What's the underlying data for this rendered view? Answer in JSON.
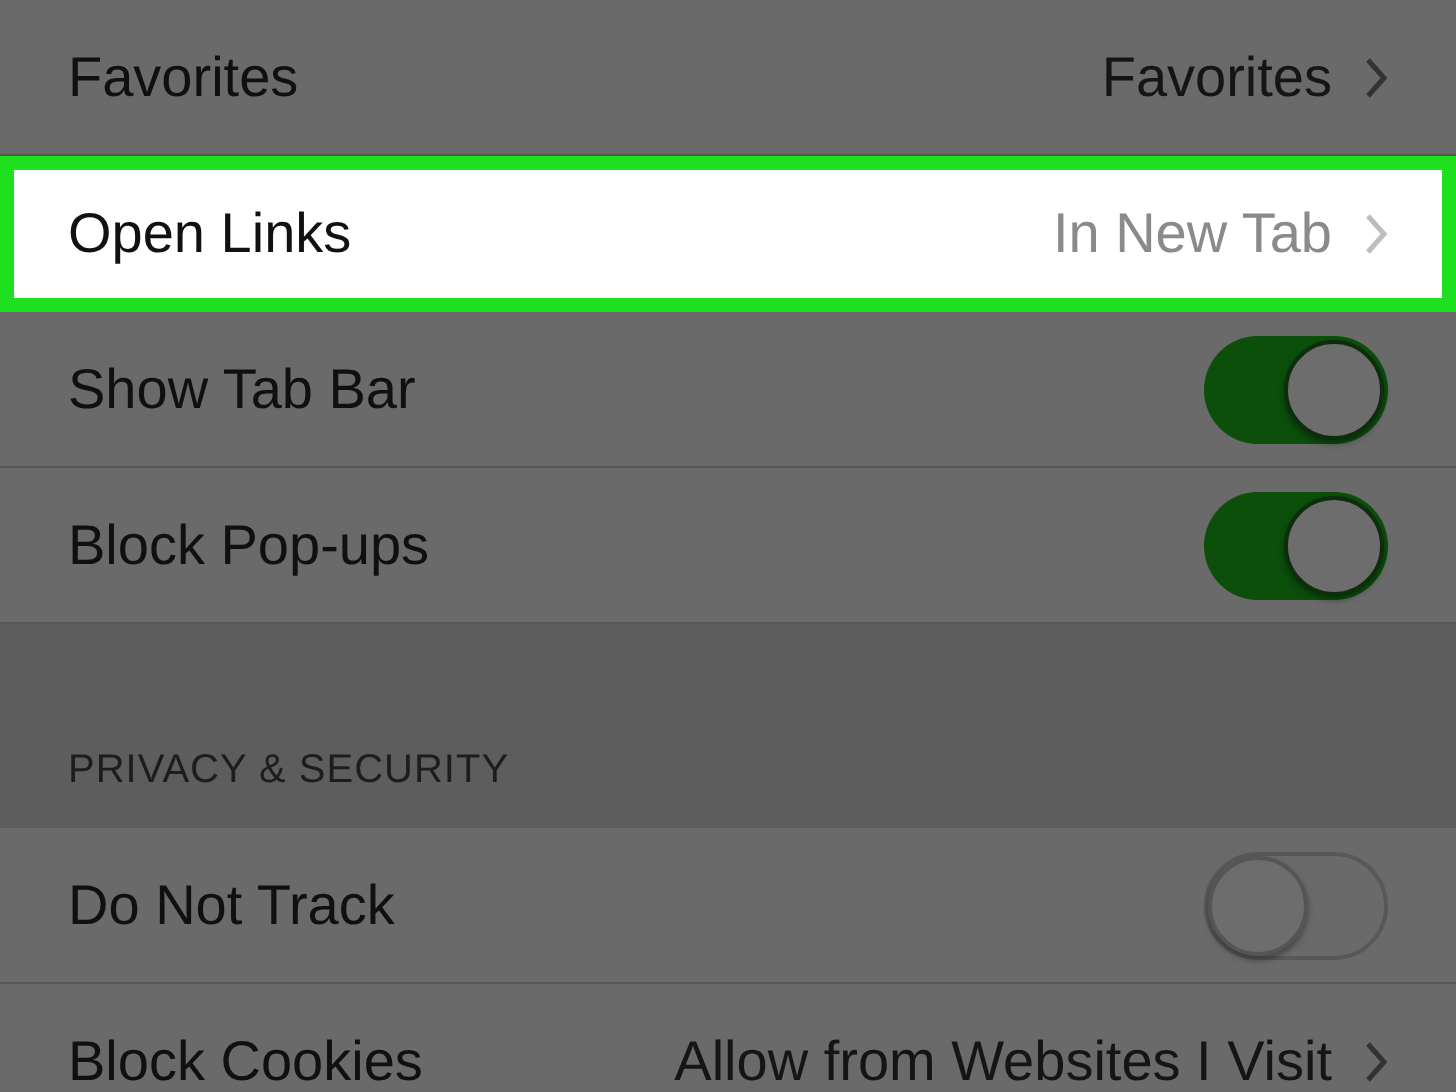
{
  "sections": [
    {
      "rows": [
        {
          "kind": "link",
          "label": "Favorites",
          "value": "Favorites",
          "selected": false
        },
        {
          "kind": "link",
          "label": "Open Links",
          "value": "In New Tab",
          "selected": true
        },
        {
          "kind": "toggle",
          "label": "Show Tab Bar",
          "on": true,
          "selected": false
        },
        {
          "kind": "toggle",
          "label": "Block Pop-ups",
          "on": true,
          "selected": false
        }
      ]
    },
    {
      "header": "PRIVACY & SECURITY",
      "rows": [
        {
          "kind": "toggle",
          "label": "Do Not Track",
          "on": false,
          "selected": false
        },
        {
          "kind": "link",
          "label": "Block Cookies",
          "value": "Allow from Websites I Visit",
          "selected": false
        }
      ]
    }
  ]
}
